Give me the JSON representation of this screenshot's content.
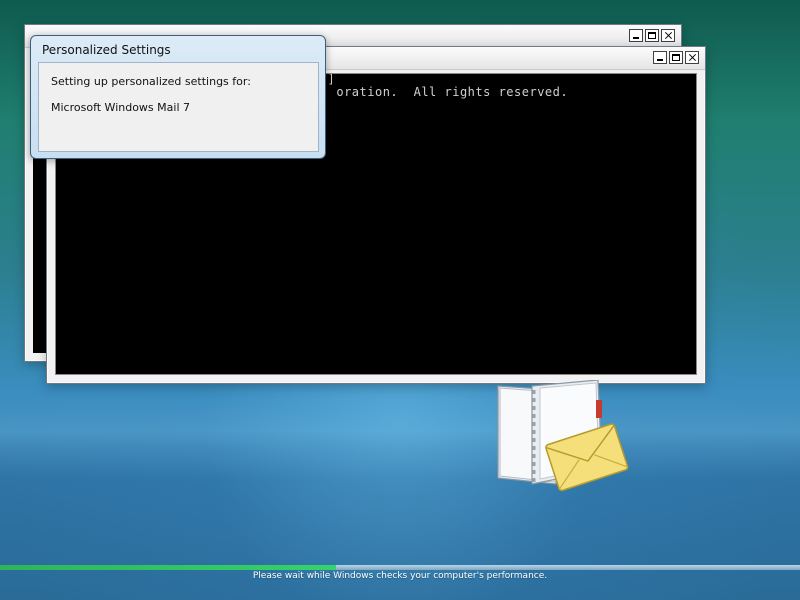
{
  "dialog": {
    "title": "Personalized Settings",
    "line1": "Setting up personalized settings for:",
    "line2": "Microsoft Windows Mail 7"
  },
  "console": {
    "line1": "02]",
    "line2": "                                   oration.  All rights reserved."
  },
  "status": {
    "text": "Please wait while Windows checks your computer's performance.",
    "progress_fraction": 0.42,
    "progress_color": "#34d36b"
  },
  "icons": {
    "mail_icon": "windows-mail-icon",
    "window_buttons": [
      "minimize-icon",
      "maximize-icon",
      "close-icon"
    ]
  }
}
